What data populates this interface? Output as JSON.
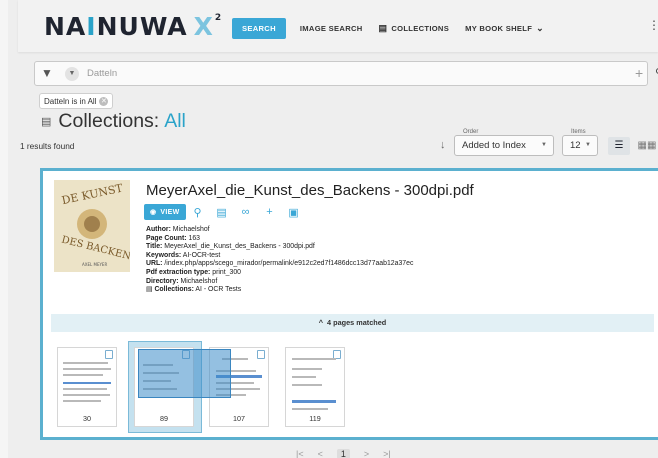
{
  "app": {
    "logo_main_a": "NA",
    "logo_accent": "I",
    "logo_main_b": "NUWA",
    "logo_x": "X",
    "logo_sup": "2"
  },
  "nav": {
    "search": "SEARCH",
    "image_search": "IMAGE SEARCH",
    "collections": "COLLECTIONS",
    "my_book_shelf": "MY BOOK SHELF",
    "menu_icon": "kebab-icon"
  },
  "search": {
    "placeholder": "Datteln",
    "filter_chip": "Datteln is in All"
  },
  "page": {
    "title_prefix": "Collections:",
    "title_accent": "All",
    "results_found": "1 results found"
  },
  "sort": {
    "order_label": "Order",
    "order_value": "Added to Index",
    "items_label": "Items",
    "items_value": "12"
  },
  "result": {
    "title": "MeyerAxel_die_Kunst_des_Backens - 300dpi.pdf",
    "view_label": "VIEW",
    "meta": {
      "author_label": "Author:",
      "author": "Michaelshof",
      "page_count_label": "Page Count:",
      "page_count": "163",
      "title_label": "Title:",
      "title": "MeyerAxel_die_Kunst_des_Backens - 300dpi.pdf",
      "keywords_label": "Keywords:",
      "keywords": "AI-OCR-test",
      "url_label": "URL:",
      "url": "/index.php/apps/scego_mirador/permalink/e912c2ed7f1486dcc13d77aab12a37ec",
      "pdf_extraction_label": "Pdf extraction type:",
      "pdf_extraction": "print_300",
      "directory_label": "Directory:",
      "directory": "Michaelshof",
      "collections_label": "Collections:",
      "collections": "AI - OCR Tests"
    },
    "pages_matched": "4 pages matched",
    "pages": [
      "30",
      "89",
      "107",
      "119"
    ]
  },
  "pagination": {
    "first": "|<",
    "prev": "<",
    "current": "1",
    "next": ">",
    "last": ">|"
  },
  "colors": {
    "accent": "#3aa7d6",
    "card_border": "#5bb0cf",
    "matched_bg": "#e2f0f5"
  }
}
